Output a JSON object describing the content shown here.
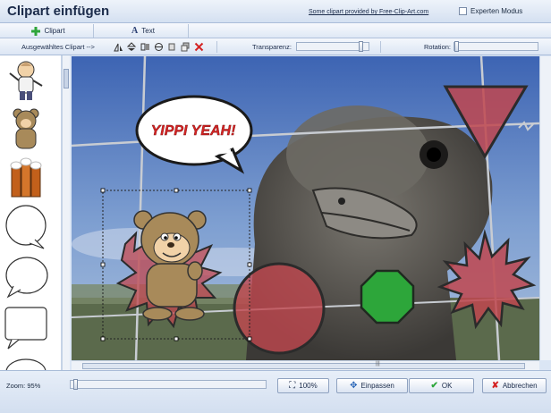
{
  "window": {
    "title": "Clipart einfügen",
    "credit_link": "Some clipart provided by Free-Clip-Art.com",
    "expert_mode_label": "Experten Modus",
    "expert_mode_checked": false
  },
  "tabs": [
    {
      "label": "Clipart",
      "icon": "plus-icon",
      "active": true
    },
    {
      "label": "Text",
      "icon": "text-a-icon",
      "active": false
    }
  ],
  "toolbar": {
    "selected_label": "Ausgewähltes Clipart -->",
    "tools": [
      "flip-horizontal-icon",
      "flip-vertical-icon",
      "mirror-icon",
      "rotate-icon",
      "copy-icon",
      "layer-icon",
      "delete-x-icon"
    ],
    "transparency_label": "Transparenz:",
    "transparency_value": 0.95,
    "rotation_label": "Rotation:",
    "rotation_value": 0
  },
  "canvas": {
    "speech_bubble_text": "YIPPI YEAH!"
  },
  "footer": {
    "zoom_label": "Zoom: 95%",
    "zoom_value": 95,
    "zoom_100_label": "100%",
    "fit_label": "Einpassen",
    "ok_label": "OK",
    "cancel_label": "Abbrechen"
  },
  "colors": {
    "shape_red": "#c0474f",
    "shape_green": "#2da63a",
    "sky": "#5a82c0"
  }
}
